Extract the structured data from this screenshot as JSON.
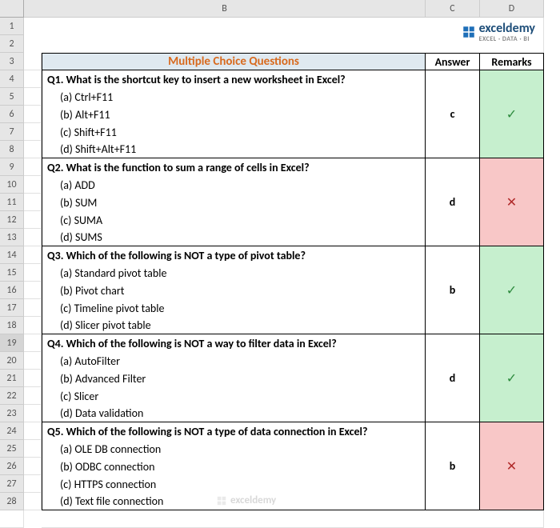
{
  "columns": [
    "A",
    "B",
    "C",
    "D"
  ],
  "rows_total": 28,
  "selected_row": 19,
  "brand": {
    "name": "exceldemy",
    "tagline": "EXCEL · DATA · BI"
  },
  "headers": {
    "title": "Multiple Choice Questions",
    "answer": "Answer",
    "remarks": "Remarks"
  },
  "marks": {
    "correct": "✓",
    "wrong": "✕"
  },
  "questions": [
    {
      "q": "Q1. What is the shortcut key to insert a new worksheet in Excel?",
      "opts": [
        "(a) Ctrl+F11",
        "(b) Alt+F11",
        "(c) Shift+F11",
        "(d) Shift+Alt+F11"
      ],
      "answer": "c",
      "correct": true
    },
    {
      "q": "Q2. What is the function to sum a range of cells in Excel?",
      "opts": [
        "(a) ADD",
        "(b) SUM",
        "(c) SUMA",
        "(d) SUMS"
      ],
      "answer": "d",
      "correct": false
    },
    {
      "q": "Q3. Which of the following is NOT a type of pivot table?",
      "opts": [
        "(a) Standard pivot table",
        "(b) Pivot chart",
        "(c) Timeline pivot table",
        "(d) Slicer pivot table"
      ],
      "answer": "b",
      "correct": true
    },
    {
      "q": "Q4. Which of the following is NOT a way to filter data in Excel?",
      "opts": [
        "(a) AutoFilter",
        "(b) Advanced Filter",
        "(c) Slicer",
        "(d) Data validation"
      ],
      "answer": "d",
      "correct": true
    },
    {
      "q": "Q5. Which of the following is NOT a type of data connection in Excel?",
      "opts": [
        "(a) OLE DB connection",
        "(b) ODBC connection",
        "(c) HTTPS connection",
        "(d) Text file connection"
      ],
      "answer": "b",
      "correct": false
    }
  ]
}
